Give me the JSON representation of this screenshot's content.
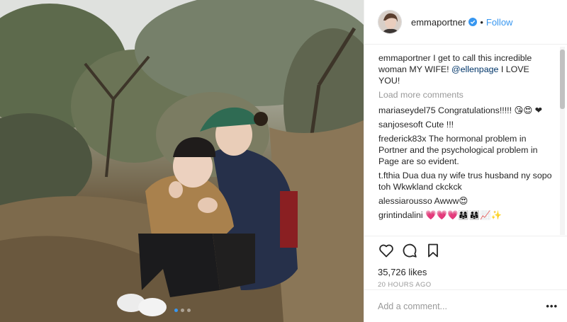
{
  "post": {
    "username": "emmaportner",
    "separator": "•",
    "follow_label": "Follow",
    "caption": {
      "user": "emmaportner",
      "text_before": " I get to call this incredible woman MY WIFE! ",
      "mention": "@ellenpage",
      "text_after": " I LOVE YOU!"
    },
    "load_more_label": "Load more comments",
    "comments": [
      {
        "user": "mariaseydel75",
        "text": " Congratulations!!!!! 😘😍 ❤"
      },
      {
        "user": "sanjosesoft",
        "text": " Cute !!!"
      },
      {
        "user": "frederick83x",
        "text": " The hormonal problem in Portner and the psychological problem in Page are so evident."
      },
      {
        "user": "t.fthia",
        "text": " Dua dua ny wife trus husband ny sopo toh Wkwkland ckckck"
      },
      {
        "user": "alessiarousso",
        "text": " Awww😍"
      },
      {
        "user": "grintindalini",
        "text": " 💗💗💗👨‍👩‍👧👨‍👩‍👧📈✨"
      }
    ],
    "likes": "35,726 likes",
    "timestamp": "20 HOURS AGO",
    "add_comment_placeholder": "Add a comment...",
    "more_label": "•••",
    "carousel": {
      "count": 3,
      "active": 1
    }
  },
  "colors": {
    "accent": "#3897f0",
    "muted": "#999999",
    "text": "#262626",
    "border": "#efefef"
  },
  "icons": [
    "verified-badge-icon",
    "heart-icon",
    "comment-icon",
    "bookmark-icon",
    "more-options-icon"
  ]
}
